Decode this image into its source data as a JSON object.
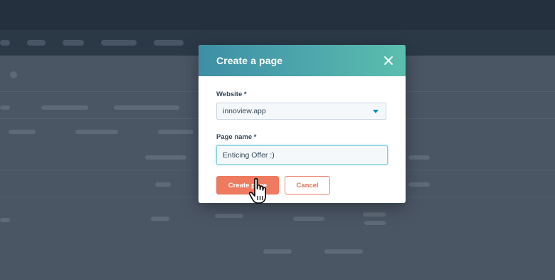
{
  "modal": {
    "title": "Create a page",
    "website_label": "Website *",
    "website_value": "innoview.app",
    "page_name_label": "Page name *",
    "page_name_value": "Enticing Offer :)",
    "create_button": "Create page",
    "cancel_button": "Cancel"
  },
  "colors": {
    "header_gradient_start": "#3e8fa4",
    "header_gradient_end": "#5bbfae",
    "primary_button": "#ee7a5f",
    "overlay_background": "#4a5666"
  },
  "icons": {
    "close": "close-icon",
    "dropdown": "chevron-down-icon",
    "cursor": "hand-pointer-icon"
  }
}
